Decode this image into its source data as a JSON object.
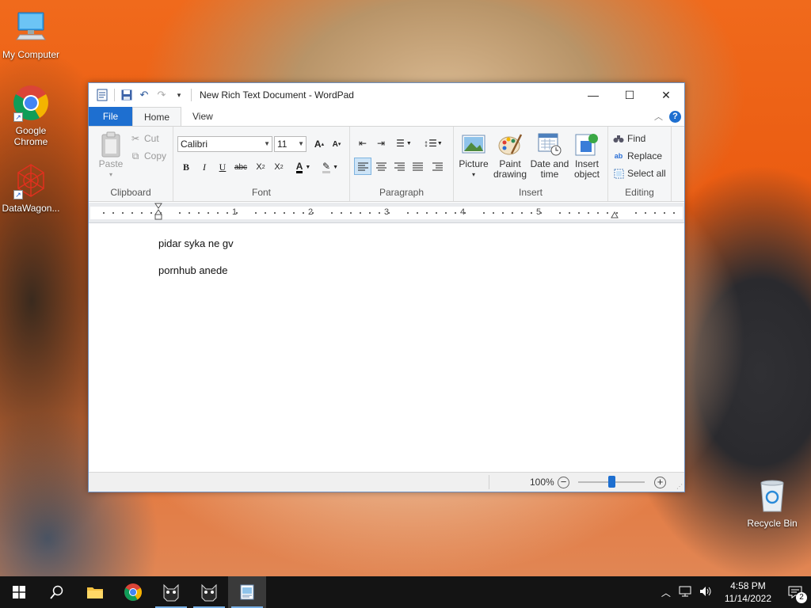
{
  "desktop": {
    "icons": [
      {
        "label": "My Computer"
      },
      {
        "label": "Google Chrome"
      },
      {
        "label": "DataWagon..."
      },
      {
        "label": "Recycle Bin"
      }
    ]
  },
  "window": {
    "title": "New Rich Text Document - WordPad",
    "tabs": {
      "file": "File",
      "home": "Home",
      "view": "View"
    },
    "help": "?"
  },
  "ribbon": {
    "clipboard": {
      "label": "Clipboard",
      "paste": "Paste",
      "cut": "Cut",
      "copy": "Copy"
    },
    "font": {
      "label": "Font",
      "family": "Calibri",
      "size": "11"
    },
    "paragraph": {
      "label": "Paragraph"
    },
    "insert": {
      "label": "Insert",
      "picture": "Picture",
      "paint1": "Paint",
      "paint2": "drawing",
      "date1": "Date and",
      "date2": "time",
      "object1": "Insert",
      "object2": "object"
    },
    "editing": {
      "label": "Editing",
      "find": "Find",
      "replace": "Replace",
      "select_all": "Select all"
    }
  },
  "ruler": {
    "numbers": [
      "1",
      "2",
      "3",
      "4",
      "5"
    ]
  },
  "document": {
    "lines": [
      "pidar syka ne gv",
      "pornhub anede"
    ]
  },
  "status": {
    "zoom": "100%",
    "zoom_level": 0.5
  },
  "taskbar": {
    "time": "4:58 PM",
    "date": "11/14/2022",
    "notifications": "2"
  },
  "colors": {
    "accent": "#1e6fd0",
    "taskbar": "#141414",
    "desktop": "#f06a1c"
  }
}
